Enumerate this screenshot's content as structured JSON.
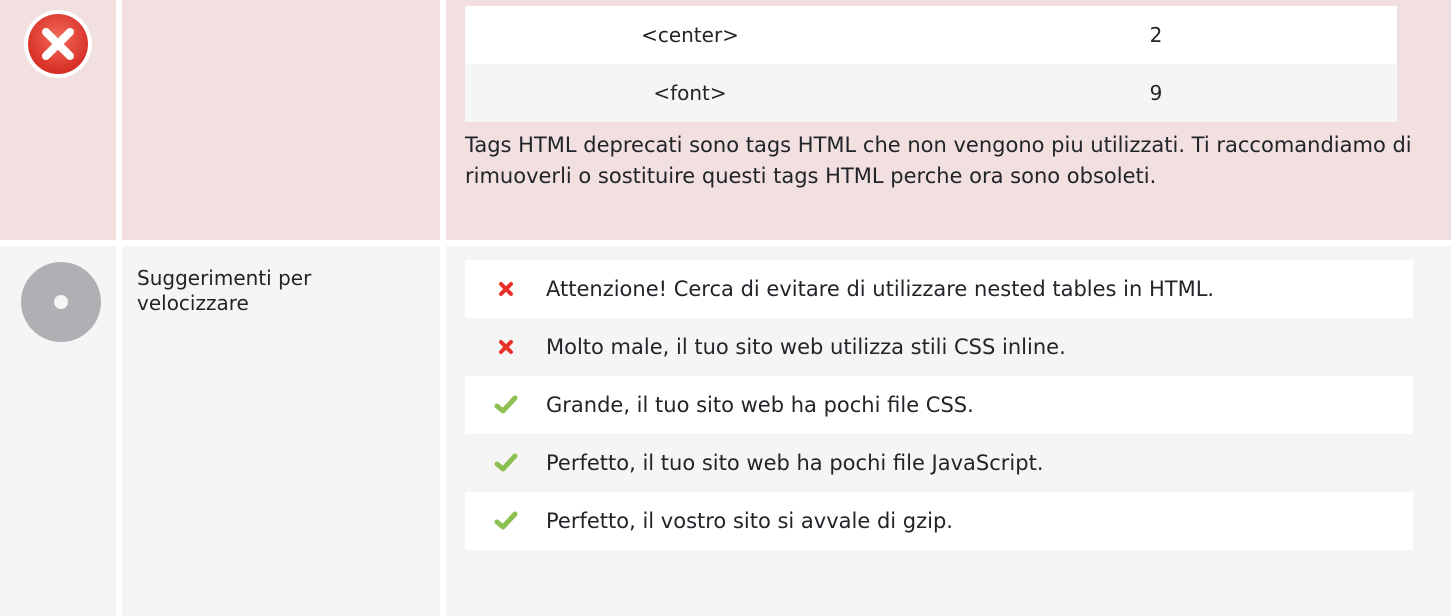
{
  "deprecated": {
    "rows": [
      {
        "tag": "<center>",
        "count": "2"
      },
      {
        "tag": "<font>",
        "count": "9"
      }
    ],
    "description": "Tags HTML deprecati sono tags HTML che non vengono piu utilizzati. Ti raccomandiamo di rimuoverli o sostituire questi tags HTML perche ora sono obsoleti.",
    "status": "error",
    "status_color": "#e0312d"
  },
  "speed": {
    "title": "Suggerimenti per velocizzare",
    "status": "neutral",
    "items": [
      {
        "status": "fail",
        "icon": "red-x-icon",
        "text": "Attenzione! Cerca di evitare di utilizzare nested tables in HTML."
      },
      {
        "status": "fail",
        "icon": "red-x-icon",
        "text": "Molto male, il tuo sito web utilizza stili CSS inline."
      },
      {
        "status": "pass",
        "icon": "green-check-icon",
        "text": "Grande, il tuo sito web ha pochi file CSS."
      },
      {
        "status": "pass",
        "icon": "green-check-icon",
        "text": "Perfetto, il tuo sito web ha pochi file JavaScript."
      },
      {
        "status": "pass",
        "icon": "green-check-icon",
        "text": "Perfetto, il vostro sito si avvale di gzip."
      }
    ]
  },
  "colors": {
    "error_bg": "#f2dfe0",
    "neutral_bg": "#f5f5f5",
    "fail": "#e8312a",
    "pass": "#8cc152"
  }
}
